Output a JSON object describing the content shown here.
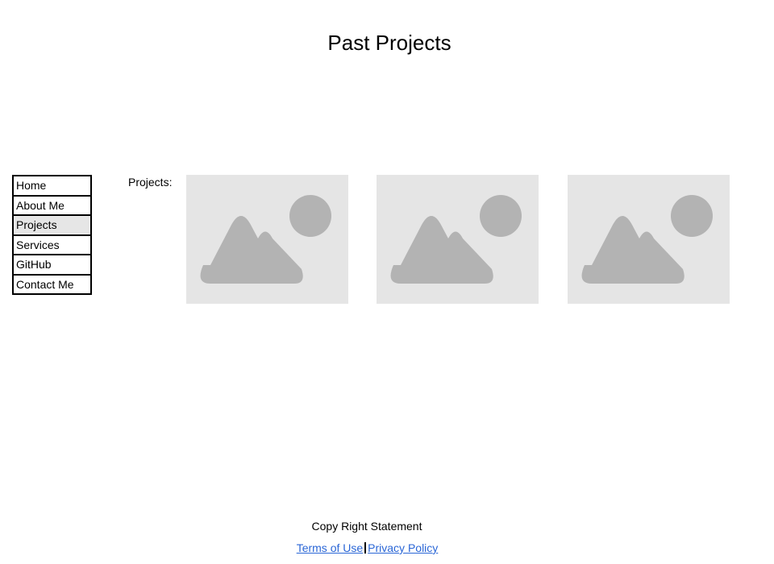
{
  "header": {
    "title": "Past Projects"
  },
  "nav": {
    "items": [
      {
        "label": "Home"
      },
      {
        "label": "About Me"
      },
      {
        "label": "Projects",
        "active": true
      },
      {
        "label": "Services"
      },
      {
        "label": "GitHub"
      },
      {
        "label": "Contact Me"
      }
    ]
  },
  "main": {
    "projects_label": "Projects:",
    "thumbnails": [
      {
        "icon": "image-placeholder-icon"
      },
      {
        "icon": "image-placeholder-icon"
      },
      {
        "icon": "image-placeholder-icon"
      }
    ]
  },
  "footer": {
    "copyright": "Copy Right Statement",
    "terms_label": "Terms of Use",
    "privacy_label": "Privacy Policy"
  },
  "colors": {
    "placeholder_bg": "#e5e5e5",
    "placeholder_shape": "#b3b3b3",
    "active_nav_bg": "#e6e6e6",
    "link": "#2a66d6"
  }
}
